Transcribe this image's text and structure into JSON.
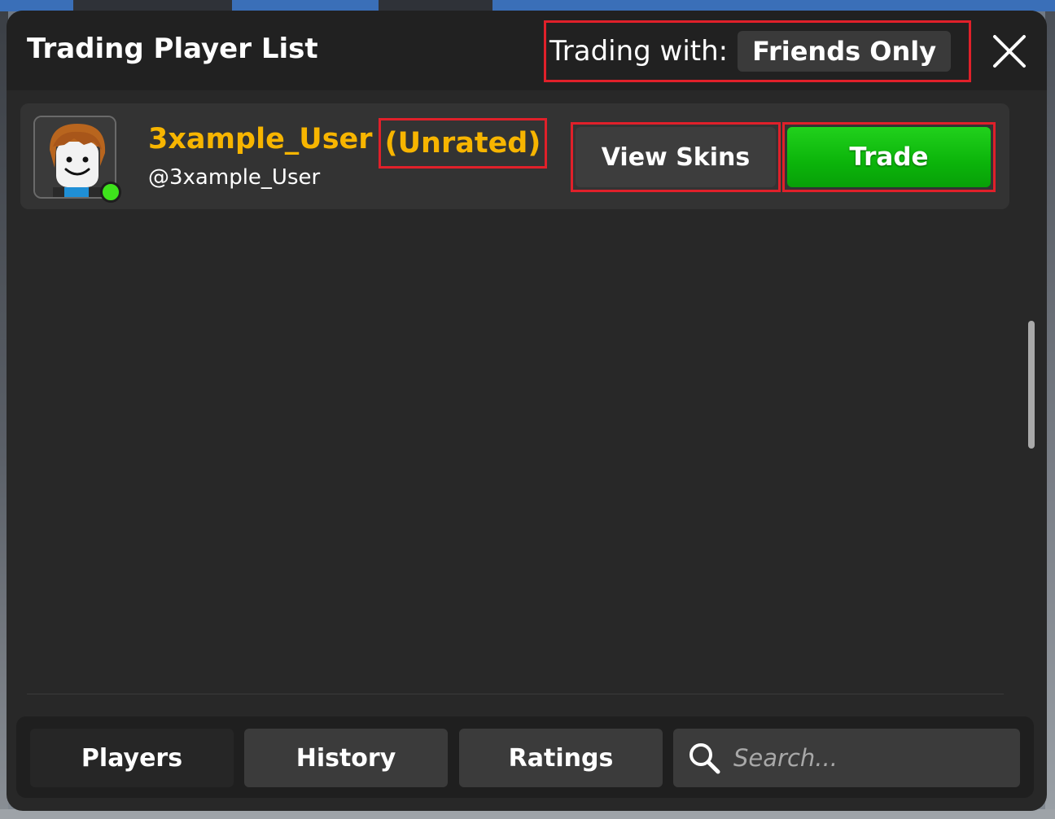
{
  "header": {
    "title": "Trading Player List",
    "trading_with_label": "Trading with:",
    "trading_mode": "Friends Only"
  },
  "players": [
    {
      "display_name": "3xample_User",
      "rating": "(Unrated)",
      "username": "@3xample_User",
      "online": true,
      "view_skins_label": "View Skins",
      "trade_label": "Trade"
    }
  ],
  "footer": {
    "tabs": [
      "Players",
      "History",
      "Ratings"
    ],
    "active_tab": "Players",
    "search_placeholder": "Search..."
  },
  "colors": {
    "accent_gold": "#f7b500",
    "trade_green": "#0bb40a",
    "online_green": "#3ee21c",
    "highlight_red": "#e0202a"
  }
}
